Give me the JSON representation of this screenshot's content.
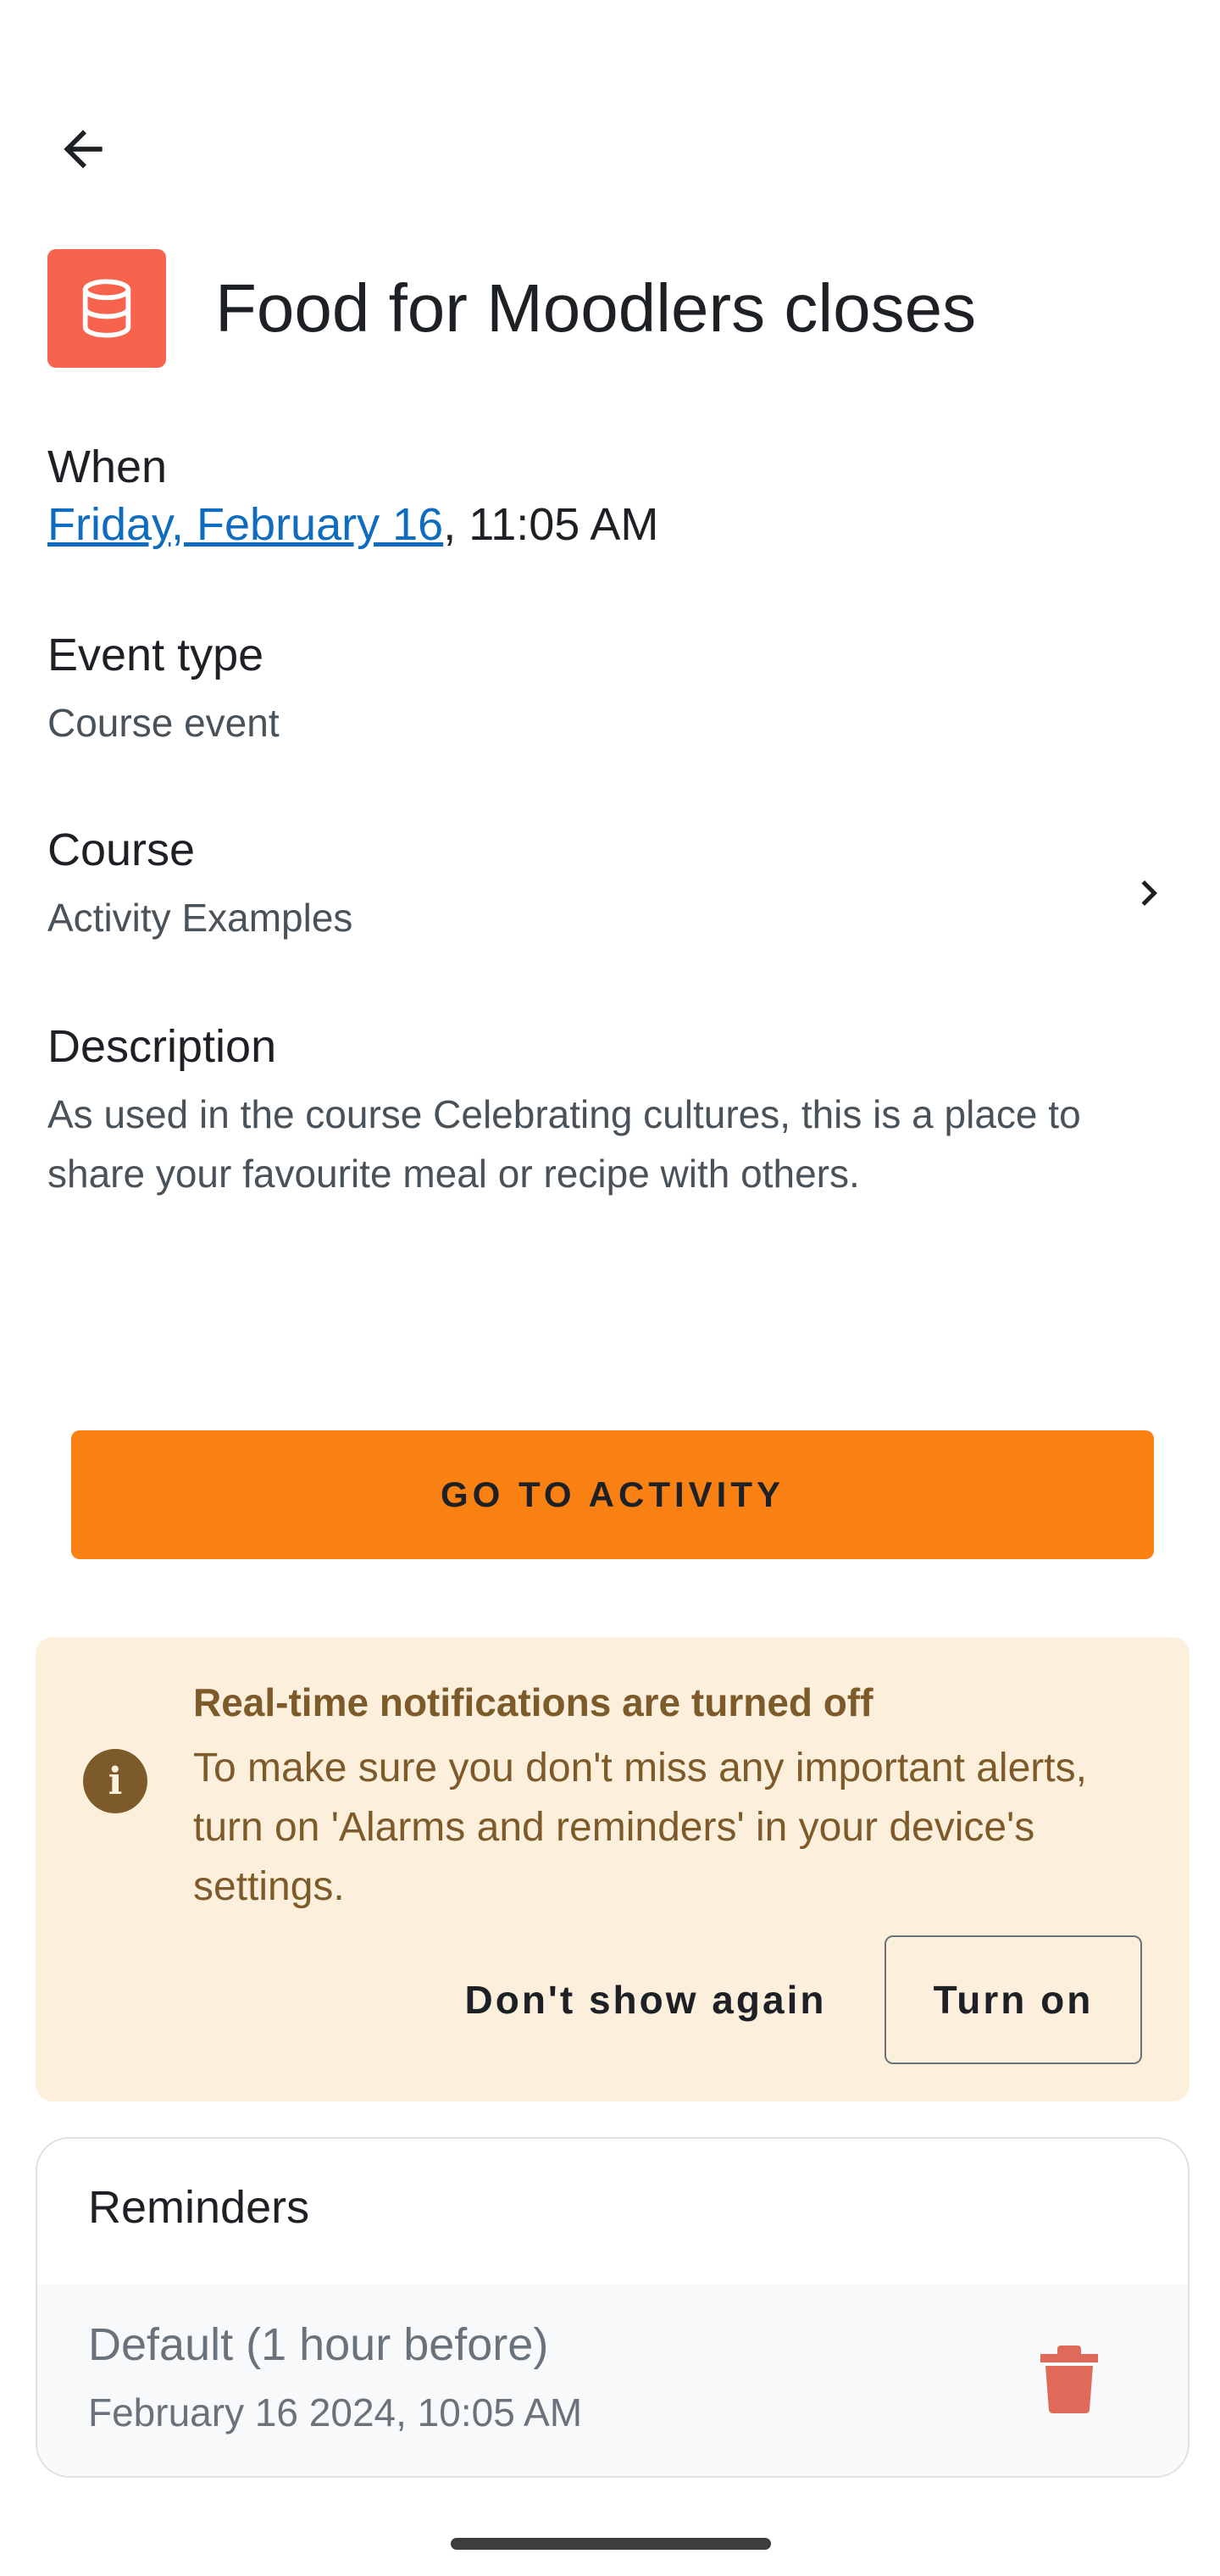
{
  "toolbar": {
    "back_icon": "arrow-left-icon"
  },
  "event": {
    "icon": "database-icon",
    "icon_color": "#f7634d",
    "title": "Food for Moodlers closes"
  },
  "when": {
    "label": "When",
    "date_link": "Friday, February 16",
    "time": ", 11:05 AM"
  },
  "event_type": {
    "label": "Event type",
    "value": "Course event"
  },
  "course": {
    "label": "Course",
    "value": "Activity Examples",
    "chevron_icon": "chevron-right-icon"
  },
  "description": {
    "label": "Description",
    "text": "As used in the course Celebrating cultures, this is a place to share your favourite meal or recipe with others."
  },
  "go_button": {
    "label": "GO TO ACTIVITY",
    "color": "#f98012"
  },
  "notice": {
    "icon": "info-icon",
    "title": "Real-time notifications are turned off",
    "body": "To make sure you don't miss any important alerts, turn on 'Alarms and reminders' in your device's settings.",
    "dismiss_label": "Don't show again",
    "turn_on_label": "Turn on",
    "background": "#fcefdc",
    "text_color": "#7d5a29"
  },
  "reminders": {
    "title": "Reminders",
    "items": [
      {
        "label": "Default (1 hour before)",
        "time": "February 16 2024, 10:05 AM",
        "delete_icon": "trash-icon"
      }
    ]
  }
}
